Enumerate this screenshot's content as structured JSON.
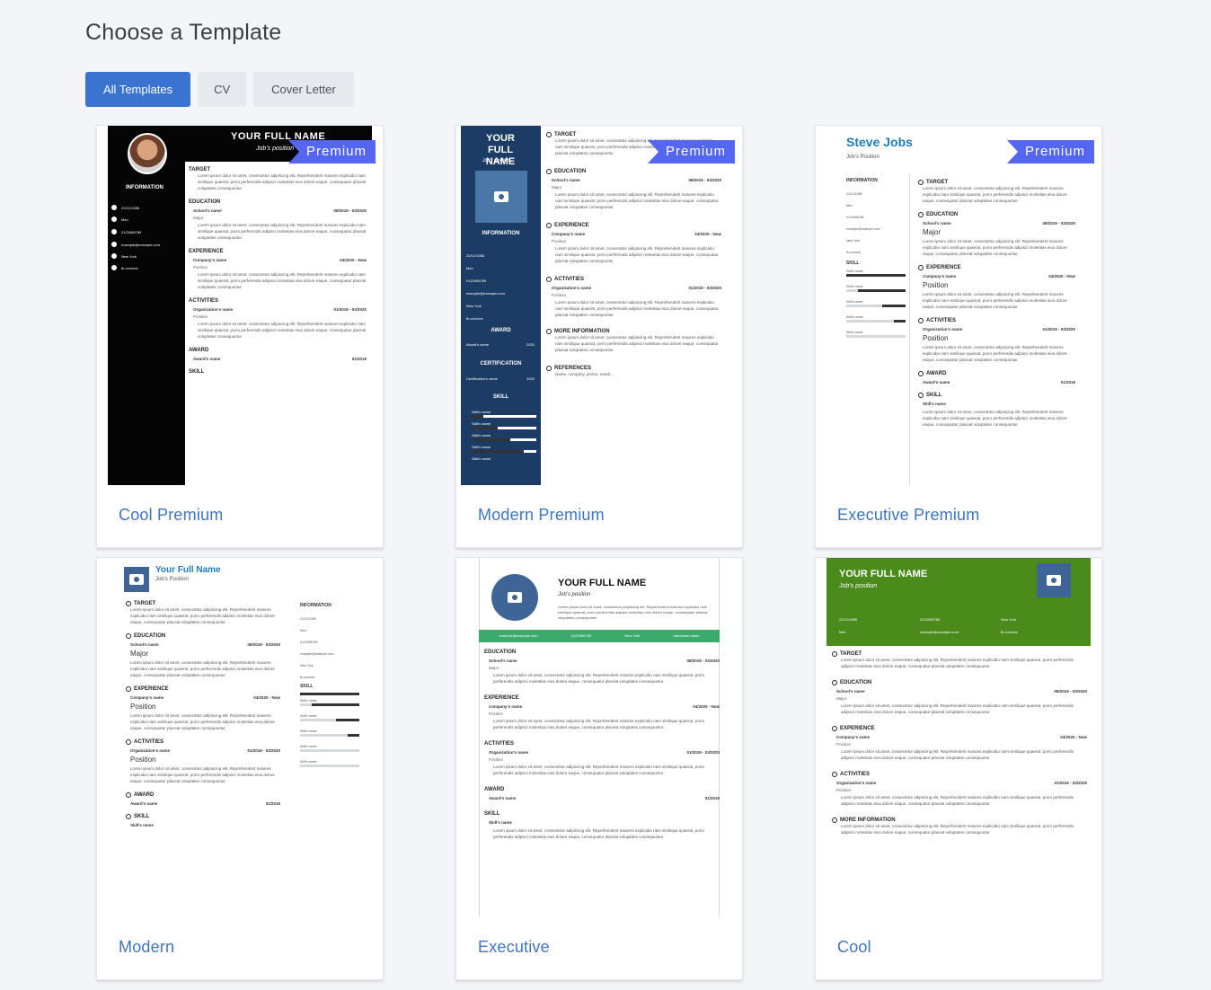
{
  "page": {
    "title": "Choose a Template"
  },
  "tabs": [
    {
      "label": "All Templates",
      "active": true
    },
    {
      "label": "CV",
      "active": false
    },
    {
      "label": "Cover Letter",
      "active": false
    }
  ],
  "badge": {
    "premium": "Premium"
  },
  "colors": {
    "accent": "#3b74d0",
    "premium": "#5567f0",
    "link": "#3f76c2"
  },
  "templates": [
    {
      "name": "Cool Premium",
      "premium": true
    },
    {
      "name": "Modern Premium",
      "premium": true
    },
    {
      "name": "Executive Premium",
      "premium": true
    },
    {
      "name": "Modern",
      "premium": false
    },
    {
      "name": "Executive",
      "premium": false
    },
    {
      "name": "Cool",
      "premium": false
    }
  ],
  "previews": {
    "cool_premium": {
      "name": "YOUR FULL NAME",
      "job": "Job's position",
      "info_title": "INFORMATION",
      "info": [
        "22/12/1985",
        "Men",
        "0123456789",
        "example@example.com",
        "New York",
        "fb.com/me"
      ],
      "sections": [
        "TARGET",
        "EDUCATION",
        "EXPERIENCE",
        "ACTIVITIES",
        "AWARD",
        "SKILL"
      ],
      "school": "School's name",
      "school_date": "08/2019 - 03/2020",
      "major": "Major",
      "company": "Company's name",
      "company_date": "04/2020 - Now",
      "position": "Position",
      "org": "Organization's name",
      "org_date": "01/2019 - 03/2020",
      "award": "Award's name",
      "award_date": "01/2019",
      "lorem": "Lorem ipsum dolor sit amet, consectetur adipiscing elit. Reprehenderit maiores explicabo nam similique quaerat, porro perferendis adipisci molestias eius dolore eaque, consequatur placeat voluptates consequuntur"
    },
    "modern_premium": {
      "name": "YOUR FULL NAME",
      "job": "Job's position",
      "side_heads": [
        "INFORMATION",
        "AWARD",
        "CERTIFICATION",
        "SKILL"
      ],
      "info": [
        "22/12/1985",
        "Men",
        "0123456789",
        "example@example.com",
        "New York",
        "fb.com/me"
      ],
      "award": "Award's name",
      "award_year": "2020",
      "cert": "Certification's name",
      "cert_year": "2020",
      "skill": "Skill's name",
      "sections": [
        "TARGET",
        "EDUCATION",
        "EXPERIENCE",
        "ACTIVITIES",
        "MORE INFORMATION",
        "REFERENCES"
      ],
      "references": "Name, company, phone, email..."
    },
    "executive_premium": {
      "name": "Steve Jobs",
      "job": "Job's Position",
      "info_title": "INFORMATION",
      "skill_title": "SKILL",
      "sections": [
        "TARGET",
        "EDUCATION",
        "EXPERIENCE",
        "ACTIVITIES",
        "AWARD",
        "SKILL"
      ],
      "major": "Major",
      "position": "Position",
      "skill_name": "Skill's name"
    },
    "modern": {
      "name": "Your Full Name",
      "job": "Job's Position",
      "info_title": "INFORMATION",
      "skill_title": "SKILL",
      "sections": [
        "TARGET",
        "EDUCATION",
        "EXPERIENCE",
        "ACTIVITIES",
        "AWARD",
        "SKILL"
      ],
      "major": "Major",
      "position": "Position",
      "skill_name": "Skill's name"
    },
    "executive": {
      "name": "YOUR FULL NAME",
      "job": "Job's position",
      "contacts": [
        "example@example.com",
        "0123456789",
        "New York",
        "username.name"
      ],
      "sections": [
        "EDUCATION",
        "EXPERIENCE",
        "ACTIVITIES",
        "AWARD",
        "SKILL"
      ]
    },
    "cool": {
      "name": "YOUR FULL NAME",
      "job": "Job's position",
      "contacts": [
        "22/12/1985",
        "0123456789",
        "New York",
        "Men",
        "example@example.com",
        "fb.com/me"
      ],
      "sections": [
        "TARGET",
        "EDUCATION",
        "EXPERIENCE",
        "ACTIVITIES",
        "MORE INFORMATION"
      ]
    }
  }
}
